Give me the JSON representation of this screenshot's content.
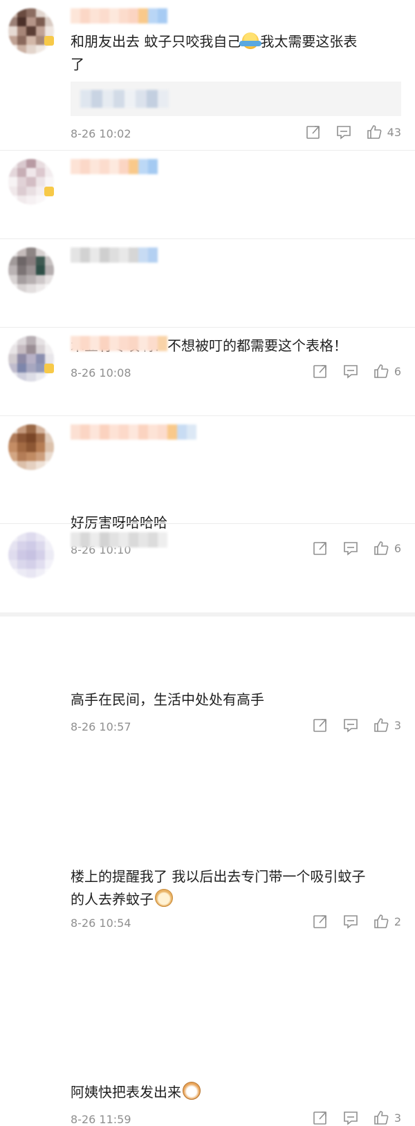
{
  "comments": [
    {
      "text_line1": "和朋友出去  蚊子只咬我自己",
      "text_line1b": "我太需要这张表",
      "text_line2": "了",
      "time": "8-26 10:02",
      "likes": "43"
    },
    {
      "text": "术业有专攻啊！不想被叮的都需要这个表格！",
      "time": "8-26 10:08",
      "likes": "6"
    },
    {
      "text": "好厉害呀哈哈哈",
      "time": "8-26 10:10",
      "likes": "6"
    },
    {
      "text": "高手在民间，生活中处处有高手",
      "time": "8-26 10:57",
      "likes": "3"
    },
    {
      "text_line1": "楼上的提醒我了 我以后出去专门带一个吸引蚊子",
      "text_line2": "的人去养蚊子",
      "time": "8-26 10:54",
      "likes": "2"
    },
    {
      "text": "阿姨快把表发出来",
      "time": "8-26 11:59",
      "likes": "3"
    }
  ],
  "icons": {
    "share": "share-icon",
    "comment": "comment-icon",
    "like": "thumbs-up-icon"
  },
  "colors": {
    "text": "#1f1f1f",
    "meta": "#8f8f8f",
    "reply_bg": "#f4f4f4",
    "vip": "#f7c948"
  }
}
